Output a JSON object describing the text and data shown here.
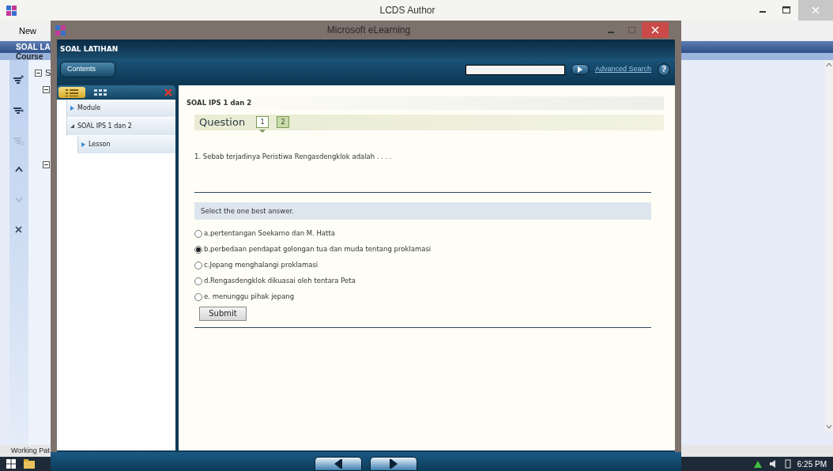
{
  "app_window": {
    "title": "LCDS Author",
    "toolbar": [
      {
        "label": "New"
      }
    ],
    "header": "SOAL LA",
    "subheader": "Course",
    "tools": [
      {
        "kind": "add-child",
        "disabled": false
      },
      {
        "kind": "add-sibling",
        "disabled": false
      },
      {
        "kind": "add-item",
        "disabled": true
      },
      {
        "kind": "up",
        "disabled": false
      },
      {
        "kind": "down",
        "disabled": true
      },
      {
        "kind": "delete",
        "disabled": false
      }
    ],
    "tree": [
      {
        "label": "S",
        "expanded": true,
        "children": [
          {
            "expanded": true
          },
          {
            "expanded": true
          }
        ]
      }
    ],
    "status_bar": "Working Pat"
  },
  "taskbar": {
    "clock": "6:25 PM"
  },
  "player_window": {
    "title": "Microsoft eLearning",
    "header": "SOAL LATIHAN",
    "contents_button": "Contents",
    "advanced_search": "Advanced Search",
    "help": "?",
    "panel_tabs": [
      {
        "kind": "list",
        "selected": true
      },
      {
        "kind": "grid",
        "selected": false
      }
    ],
    "tree": [
      {
        "label": "Module",
        "expanded": false
      },
      {
        "label": "SOAL IPS 1 dan 2",
        "expanded": true,
        "children": [
          {
            "label": "Lesson",
            "expanded": false
          }
        ]
      }
    ],
    "content": {
      "title": "SOAL IPS 1 dan 2",
      "question_label": "Question",
      "question_tabs": [
        {
          "label": "1",
          "selected": true
        },
        {
          "label": "2",
          "selected": false
        }
      ],
      "question_text": "1. Sebab terjadinya Peristiwa Rengasdengklok adalah . . . .",
      "instruction": "Select the one best answer.",
      "options": [
        {
          "label": "a.pertentangan Soekarno dan M. Hatta",
          "selected": false
        },
        {
          "label": "b.perbedaan pendapat golongan tua dan muda tentang proklamasi",
          "selected": true
        },
        {
          "label": "c.Jepang menghalangi proklamasi",
          "selected": false
        },
        {
          "label": "d.Rengasdengklok dikuasai oleh tentara Peta",
          "selected": false
        },
        {
          "label": "e. menunggu pihak jepang",
          "selected": false
        }
      ],
      "submit": "Submit"
    }
  }
}
